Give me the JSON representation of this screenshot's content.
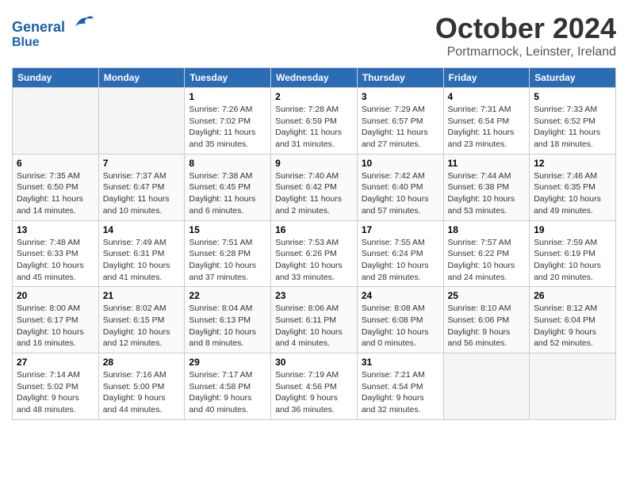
{
  "header": {
    "logo_line1": "General",
    "logo_line2": "Blue",
    "month": "October 2024",
    "location": "Portmarnock, Leinster, Ireland"
  },
  "weekdays": [
    "Sunday",
    "Monday",
    "Tuesday",
    "Wednesday",
    "Thursday",
    "Friday",
    "Saturday"
  ],
  "weeks": [
    [
      {
        "day": "",
        "info": ""
      },
      {
        "day": "",
        "info": ""
      },
      {
        "day": "1",
        "info": "Sunrise: 7:26 AM\nSunset: 7:02 PM\nDaylight: 11 hours and 35 minutes."
      },
      {
        "day": "2",
        "info": "Sunrise: 7:28 AM\nSunset: 6:59 PM\nDaylight: 11 hours and 31 minutes."
      },
      {
        "day": "3",
        "info": "Sunrise: 7:29 AM\nSunset: 6:57 PM\nDaylight: 11 hours and 27 minutes."
      },
      {
        "day": "4",
        "info": "Sunrise: 7:31 AM\nSunset: 6:54 PM\nDaylight: 11 hours and 23 minutes."
      },
      {
        "day": "5",
        "info": "Sunrise: 7:33 AM\nSunset: 6:52 PM\nDaylight: 11 hours and 18 minutes."
      }
    ],
    [
      {
        "day": "6",
        "info": "Sunrise: 7:35 AM\nSunset: 6:50 PM\nDaylight: 11 hours and 14 minutes."
      },
      {
        "day": "7",
        "info": "Sunrise: 7:37 AM\nSunset: 6:47 PM\nDaylight: 11 hours and 10 minutes."
      },
      {
        "day": "8",
        "info": "Sunrise: 7:38 AM\nSunset: 6:45 PM\nDaylight: 11 hours and 6 minutes."
      },
      {
        "day": "9",
        "info": "Sunrise: 7:40 AM\nSunset: 6:42 PM\nDaylight: 11 hours and 2 minutes."
      },
      {
        "day": "10",
        "info": "Sunrise: 7:42 AM\nSunset: 6:40 PM\nDaylight: 10 hours and 57 minutes."
      },
      {
        "day": "11",
        "info": "Sunrise: 7:44 AM\nSunset: 6:38 PM\nDaylight: 10 hours and 53 minutes."
      },
      {
        "day": "12",
        "info": "Sunrise: 7:46 AM\nSunset: 6:35 PM\nDaylight: 10 hours and 49 minutes."
      }
    ],
    [
      {
        "day": "13",
        "info": "Sunrise: 7:48 AM\nSunset: 6:33 PM\nDaylight: 10 hours and 45 minutes."
      },
      {
        "day": "14",
        "info": "Sunrise: 7:49 AM\nSunset: 6:31 PM\nDaylight: 10 hours and 41 minutes."
      },
      {
        "day": "15",
        "info": "Sunrise: 7:51 AM\nSunset: 6:28 PM\nDaylight: 10 hours and 37 minutes."
      },
      {
        "day": "16",
        "info": "Sunrise: 7:53 AM\nSunset: 6:26 PM\nDaylight: 10 hours and 33 minutes."
      },
      {
        "day": "17",
        "info": "Sunrise: 7:55 AM\nSunset: 6:24 PM\nDaylight: 10 hours and 28 minutes."
      },
      {
        "day": "18",
        "info": "Sunrise: 7:57 AM\nSunset: 6:22 PM\nDaylight: 10 hours and 24 minutes."
      },
      {
        "day": "19",
        "info": "Sunrise: 7:59 AM\nSunset: 6:19 PM\nDaylight: 10 hours and 20 minutes."
      }
    ],
    [
      {
        "day": "20",
        "info": "Sunrise: 8:00 AM\nSunset: 6:17 PM\nDaylight: 10 hours and 16 minutes."
      },
      {
        "day": "21",
        "info": "Sunrise: 8:02 AM\nSunset: 6:15 PM\nDaylight: 10 hours and 12 minutes."
      },
      {
        "day": "22",
        "info": "Sunrise: 8:04 AM\nSunset: 6:13 PM\nDaylight: 10 hours and 8 minutes."
      },
      {
        "day": "23",
        "info": "Sunrise: 8:06 AM\nSunset: 6:11 PM\nDaylight: 10 hours and 4 minutes."
      },
      {
        "day": "24",
        "info": "Sunrise: 8:08 AM\nSunset: 6:08 PM\nDaylight: 10 hours and 0 minutes."
      },
      {
        "day": "25",
        "info": "Sunrise: 8:10 AM\nSunset: 6:06 PM\nDaylight: 9 hours and 56 minutes."
      },
      {
        "day": "26",
        "info": "Sunrise: 8:12 AM\nSunset: 6:04 PM\nDaylight: 9 hours and 52 minutes."
      }
    ],
    [
      {
        "day": "27",
        "info": "Sunrise: 7:14 AM\nSunset: 5:02 PM\nDaylight: 9 hours and 48 minutes."
      },
      {
        "day": "28",
        "info": "Sunrise: 7:16 AM\nSunset: 5:00 PM\nDaylight: 9 hours and 44 minutes."
      },
      {
        "day": "29",
        "info": "Sunrise: 7:17 AM\nSunset: 4:58 PM\nDaylight: 9 hours and 40 minutes."
      },
      {
        "day": "30",
        "info": "Sunrise: 7:19 AM\nSunset: 4:56 PM\nDaylight: 9 hours and 36 minutes."
      },
      {
        "day": "31",
        "info": "Sunrise: 7:21 AM\nSunset: 4:54 PM\nDaylight: 9 hours and 32 minutes."
      },
      {
        "day": "",
        "info": ""
      },
      {
        "day": "",
        "info": ""
      }
    ]
  ]
}
